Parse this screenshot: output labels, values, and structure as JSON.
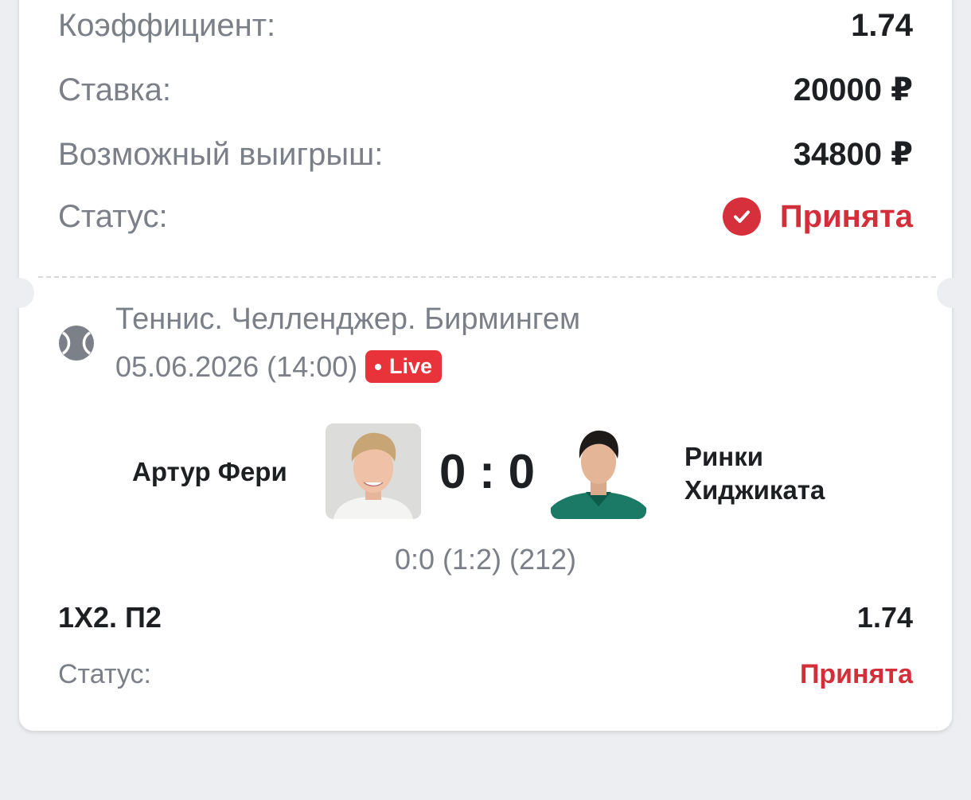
{
  "summary": {
    "rows": [
      {
        "label": "Коэффициент:",
        "value": "1.74"
      },
      {
        "label": "Ставка:",
        "value": "20000 ₽"
      },
      {
        "label": "Возможный выигрыш:",
        "value": "34800 ₽"
      }
    ],
    "status_label": "Статус:",
    "status_value": "Принята"
  },
  "event": {
    "sport_icon": "tennis-ball-icon",
    "tournament": "Теннис. Челленджер. Бирмингем",
    "datetime": "05.06.2026 (14:00)",
    "live_label": "Live",
    "team1": "Артур Фери",
    "team2_line1": "Ринки",
    "team2_line2": "Хиджиката",
    "score": "0 : 0",
    "sets": "0:0 (1:2) (212)"
  },
  "bet": {
    "market": "1X2. П2",
    "odds": "1.74",
    "status_label": "Статус:",
    "status_value": "Принята"
  },
  "colors": {
    "accent_red": "#d32f3a",
    "live_red": "#e8333a",
    "muted_text": "#7a7f88",
    "background": "#eceef1"
  }
}
